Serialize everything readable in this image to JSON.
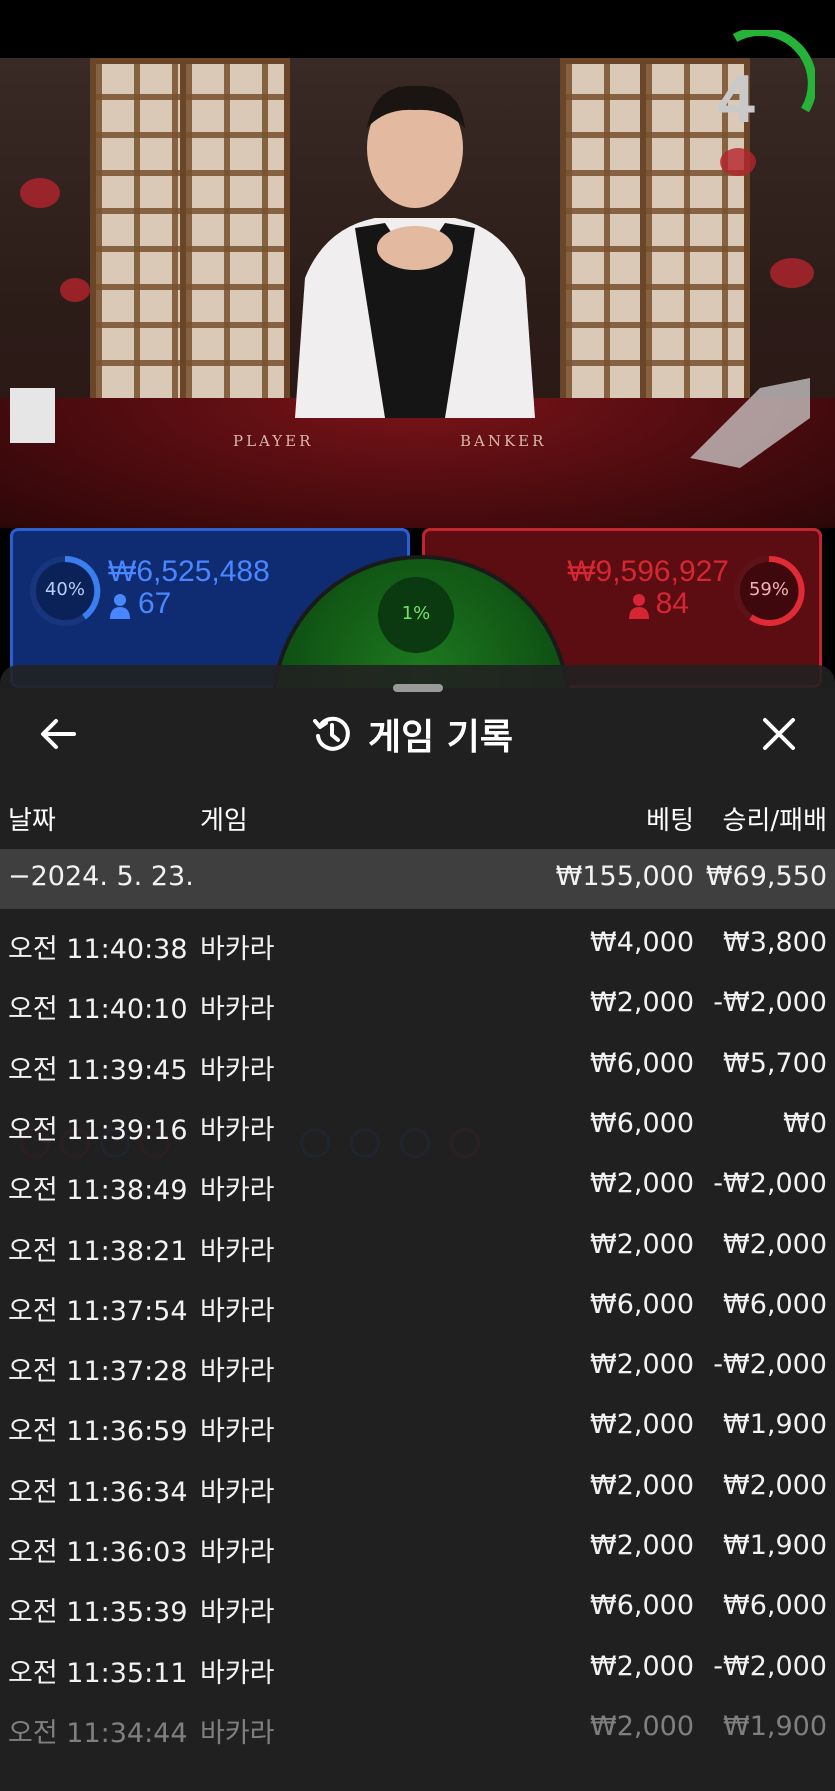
{
  "countdown": "4",
  "video": {
    "table_labels": [
      "PLAYER",
      "BANKER"
    ]
  },
  "player": {
    "percent": "40%",
    "amount": "₩6,525,488",
    "players": "67",
    "percent_value": 0.4
  },
  "banker": {
    "percent": "59%",
    "amount": "₩9,596,927",
    "players": "84",
    "percent_value": 0.59
  },
  "tie": {
    "percent": "1%"
  },
  "colors": {
    "player": "#2c5fd1",
    "banker": "#c3252f",
    "tie": "#1d7a1f",
    "sheet": "#212121"
  },
  "sheet": {
    "title": "게임 기록",
    "icons": {
      "back": "arrow-left-icon",
      "title": "history-icon",
      "close": "close-icon"
    },
    "headers": {
      "date": "날짜",
      "game": "게임",
      "bet": "베팅",
      "result": "승리/패배"
    },
    "summary": {
      "date": "−2024. 5. 23.",
      "bet": "₩155,000",
      "result": "₩69,550"
    },
    "rows": [
      {
        "time": "오전 11:40:38",
        "game": "바카라",
        "bet": "₩4,000",
        "result": "₩3,800"
      },
      {
        "time": "오전 11:40:10",
        "game": "바카라",
        "bet": "₩2,000",
        "result": "-₩2,000"
      },
      {
        "time": "오전 11:39:45",
        "game": "바카라",
        "bet": "₩6,000",
        "result": "₩5,700"
      },
      {
        "time": "오전 11:39:16",
        "game": "바카라",
        "bet": "₩6,000",
        "result": "₩0"
      },
      {
        "time": "오전 11:38:49",
        "game": "바카라",
        "bet": "₩2,000",
        "result": "-₩2,000"
      },
      {
        "time": "오전 11:38:21",
        "game": "바카라",
        "bet": "₩2,000",
        "result": "₩2,000"
      },
      {
        "time": "오전 11:37:54",
        "game": "바카라",
        "bet": "₩6,000",
        "result": "₩6,000"
      },
      {
        "time": "오전 11:37:28",
        "game": "바카라",
        "bet": "₩2,000",
        "result": "-₩2,000"
      },
      {
        "time": "오전 11:36:59",
        "game": "바카라",
        "bet": "₩2,000",
        "result": "₩1,900"
      },
      {
        "time": "오전 11:36:34",
        "game": "바카라",
        "bet": "₩2,000",
        "result": "₩2,000"
      },
      {
        "time": "오전 11:36:03",
        "game": "바카라",
        "bet": "₩2,000",
        "result": "₩1,900"
      },
      {
        "time": "오전 11:35:39",
        "game": "바카라",
        "bet": "₩6,000",
        "result": "₩6,000"
      },
      {
        "time": "오전 11:35:11",
        "game": "바카라",
        "bet": "₩2,000",
        "result": "-₩2,000"
      },
      {
        "time": "오전 11:34:44",
        "game": "바카라",
        "bet": "₩2,000",
        "result": "₩1,900"
      }
    ]
  }
}
